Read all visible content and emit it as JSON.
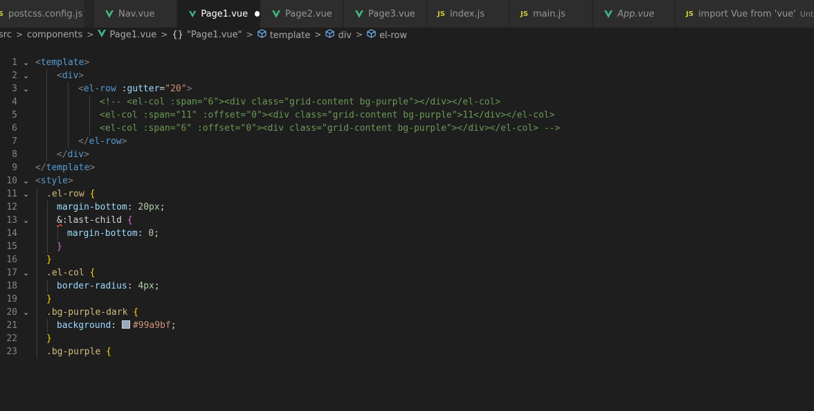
{
  "tabs": [
    {
      "icon": "js",
      "label": "postcss.config.js"
    },
    {
      "icon": "vue",
      "label": "Nav.vue"
    },
    {
      "icon": "vue",
      "label": "Page1.vue",
      "active": true,
      "modified": true
    },
    {
      "icon": "vue",
      "label": "Page2.vue"
    },
    {
      "icon": "vue",
      "label": "Page3.vue"
    },
    {
      "icon": "js",
      "label": "index.js"
    },
    {
      "icon": "js",
      "label": "main.js"
    },
    {
      "icon": "vue",
      "label": "App.vue",
      "italic": true
    },
    {
      "icon": "js",
      "label": "import Vue from 'vue'",
      "desc": "Untitled"
    }
  ],
  "breadcrumb": {
    "items": [
      "src",
      "components",
      "Page1.vue",
      "\"Page1.vue\"",
      "template",
      "div",
      "el-row"
    ],
    "obj_glyph": "{}"
  },
  "colors": {
    "swatch": "#99a9bf",
    "vue": "#41b883",
    "js": "#cbcb41"
  },
  "editor": {
    "line_numbers": [
      "1",
      "2",
      "3",
      "4",
      "5",
      "6",
      "7",
      "8",
      "9",
      "10",
      "11",
      "12",
      "13",
      "14",
      "15",
      "16",
      "17",
      "18",
      "19",
      "20",
      "21",
      "22",
      "23"
    ],
    "code": {
      "l2_open": "<",
      "l2_tag": "template",
      "l2_close": ">",
      "l3_open": "<",
      "l3_tag": "div",
      "l3_close": ">",
      "l4_open": "<",
      "l4_tag": "el-row",
      "l4_attr": ":gutter",
      "l4_eq": "=",
      "l4_val": "\"20\"",
      "l4_close": ">",
      "l5": "<!-- <el-col :span=\"6\"><div class=\"grid-content bg-purple\"></div></el-col>",
      "l6": "<el-col :span=\"11\" :offset=\"0\"><div class=\"grid-content bg-purple\">11</div></el-col>",
      "l7": "<el-col :span=\"6\" :offset=\"0\"><div class=\"grid-content bg-purple\"></div></el-col> -->",
      "l8_open": "</",
      "l8_tag": "el-row",
      "l8_close": ">",
      "l9_open": "</",
      "l9_tag": "div",
      "l9_close": ">",
      "l10_open": "</",
      "l10_tag": "template",
      "l10_close": ">",
      "l11_open": "<",
      "l11_tag": "style",
      "l11_close": ">",
      "l12_sel": ".el-row",
      "l12_brace": "{",
      "l13_prop": "margin-bottom",
      "l13_colon": ": ",
      "l13_val": "20px",
      "l13_semi": ";",
      "l14_amp": "&",
      "l14_sel": ":last-child",
      "l14_brace": "{",
      "l15_prop": "margin-bottom",
      "l15_colon": ": ",
      "l15_val": "0",
      "l15_semi": ";",
      "l16_brace": "}",
      "l17_brace": "}",
      "l18_sel": ".el-col",
      "l18_brace": "{",
      "l19_prop": "border-radius",
      "l19_colon": ": ",
      "l19_val": "4px",
      "l19_semi": ";",
      "l20_brace": "}",
      "l21_sel": ".bg-purple-dark",
      "l21_brace": "{",
      "l22_prop": "background",
      "l22_colon": ": ",
      "l22_val": "#99a9bf",
      "l22_semi": ";",
      "l23_brace": "}",
      "l24_sel": ".bg-purple",
      "l24_brace": "{"
    }
  }
}
